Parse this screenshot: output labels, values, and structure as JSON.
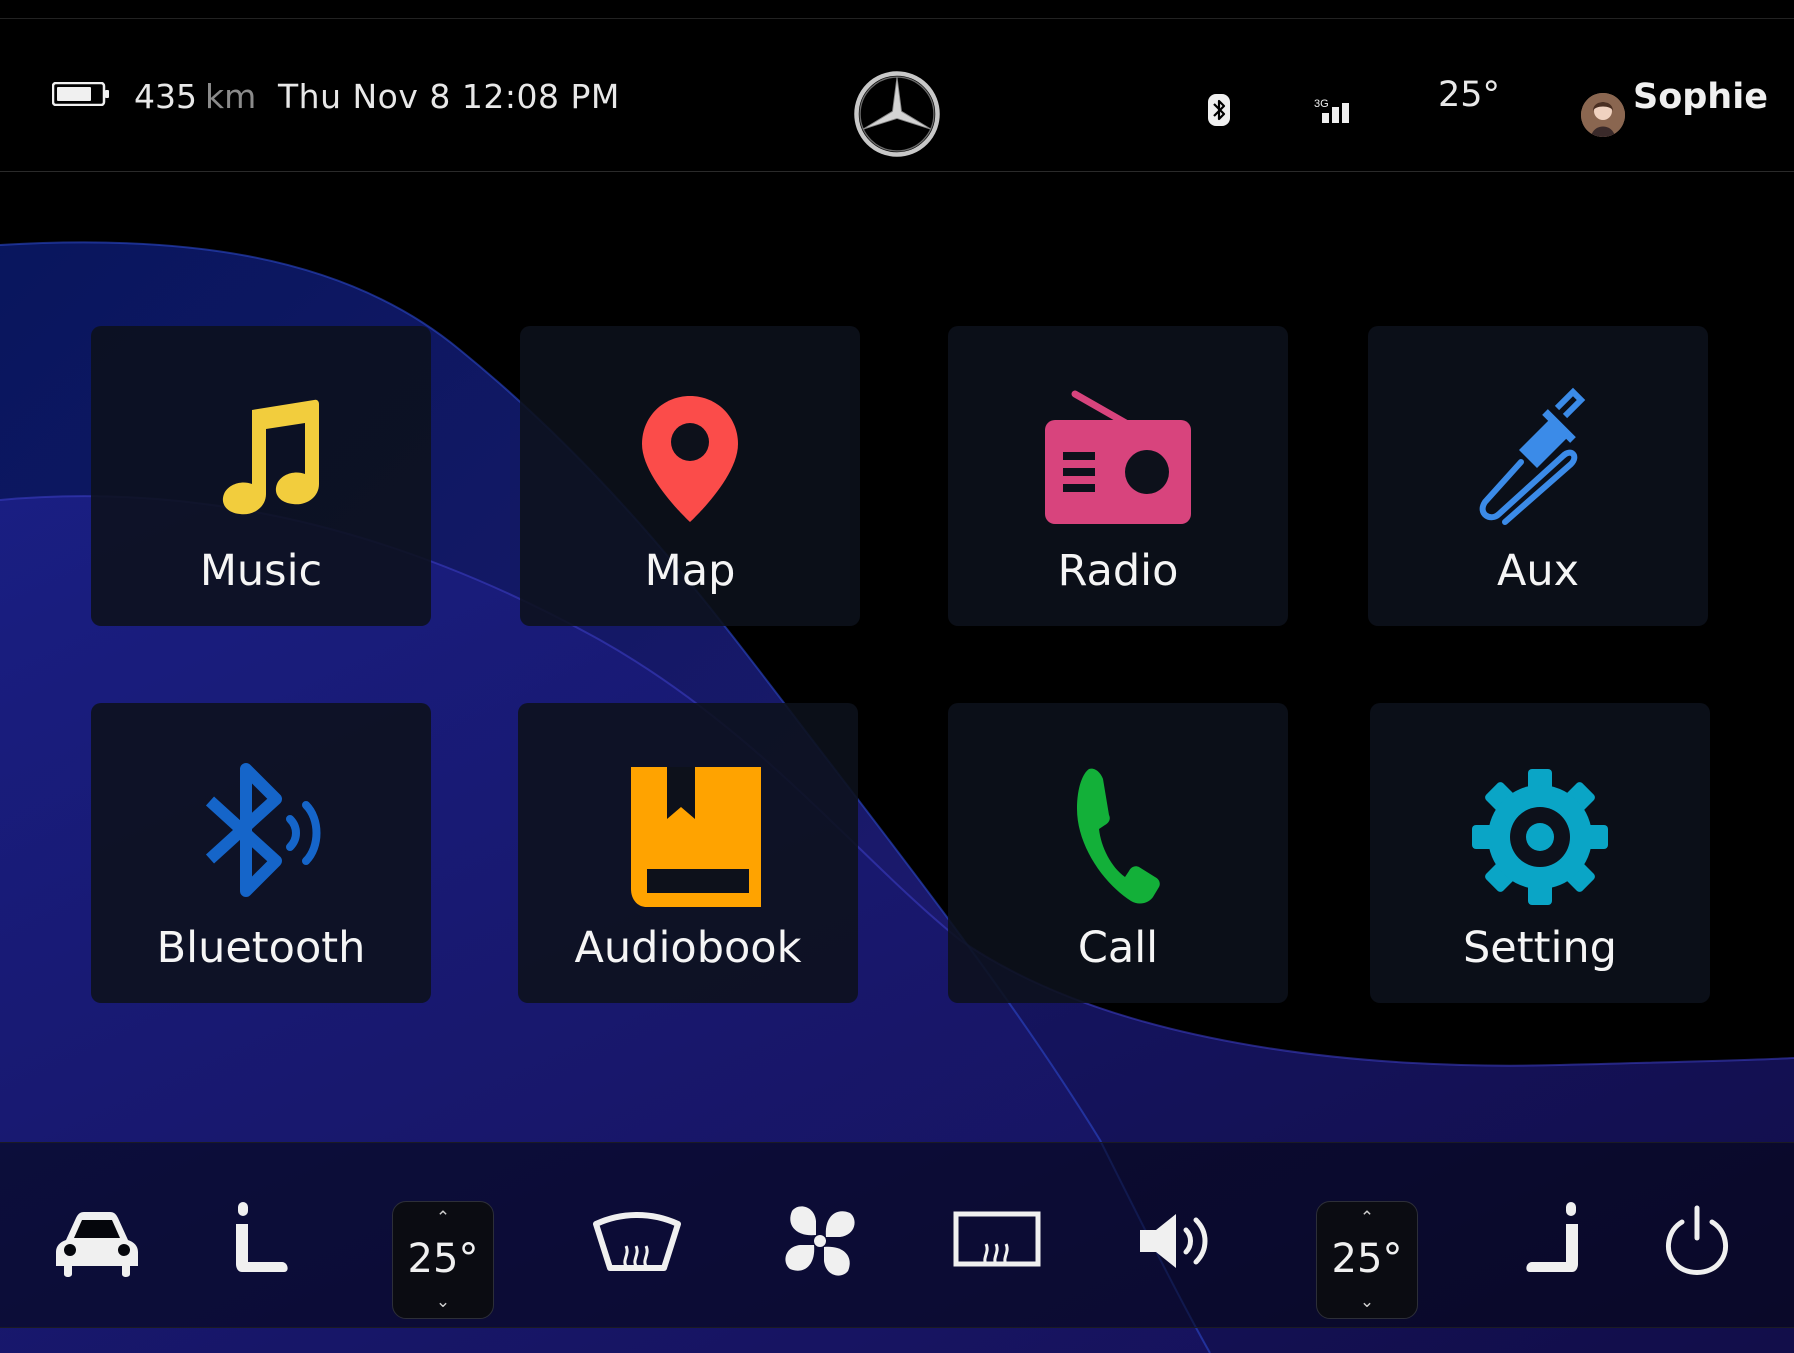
{
  "status": {
    "range_value": "435",
    "range_unit": "km",
    "datetime": "Thu Nov 8 12:08 PM",
    "signal_label": "3G",
    "outside_temp": "25°",
    "user_name": "Sophie"
  },
  "apps": [
    {
      "label": "Music",
      "color": "#f2cd3d",
      "icon": "music-note-icon"
    },
    {
      "label": "Map",
      "color": "#fb4c4a",
      "icon": "map-pin-icon"
    },
    {
      "label": "Radio",
      "color": "#d8447d",
      "icon": "radio-icon"
    },
    {
      "label": "Aux",
      "color": "#3b8be8",
      "icon": "aux-cable-icon"
    },
    {
      "label": "Bluetooth",
      "color": "#1565c9",
      "icon": "bluetooth-icon"
    },
    {
      "label": "Audiobook",
      "color": "#ffa300",
      "icon": "book-icon"
    },
    {
      "label": "Call",
      "color": "#13b039",
      "icon": "phone-icon"
    },
    {
      "label": "Setting",
      "color": "#0aa5c6",
      "icon": "gear-icon"
    }
  ],
  "climate": {
    "left_temp": "25°",
    "right_temp": "25°",
    "up_arrow": "⌃",
    "down_arrow": "⌄"
  }
}
